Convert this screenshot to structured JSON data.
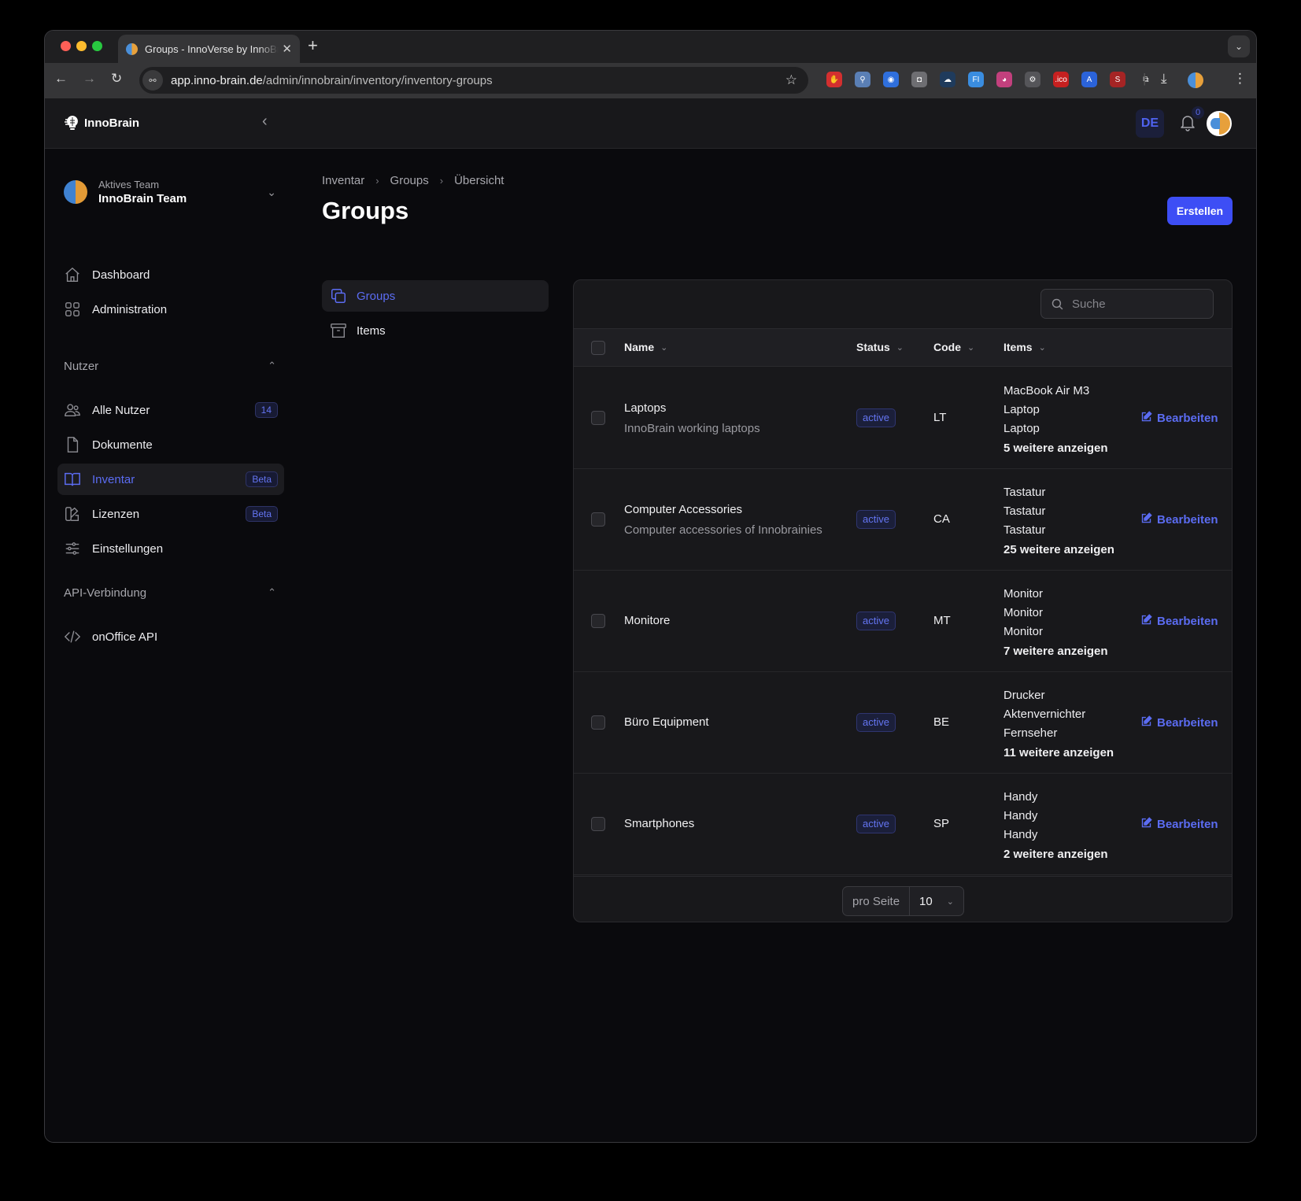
{
  "browser": {
    "tab_title": "Groups - InnoVerse by InnoBrain",
    "url_host": "app.inno-brain.de",
    "url_path": "/admin/innobrain/inventory/inventory-groups",
    "extensions": [
      {
        "name": "adblock-icon",
        "color": "#d32f2f",
        "glyph": "✋"
      },
      {
        "name": "magnifier-extension-icon",
        "color": "#5a7fb5",
        "glyph": "⚲"
      },
      {
        "name": "onepassword-icon",
        "color": "#2f6fdc",
        "glyph": "◉"
      },
      {
        "name": "camera-icon",
        "color": "#6e6e72",
        "glyph": "◘"
      },
      {
        "name": "cloud-extension-icon",
        "color": "#1f3b5c",
        "glyph": "☁"
      },
      {
        "name": "fi-extension-icon",
        "color": "#3a8de0",
        "glyph": "FI"
      },
      {
        "name": "octopus-extension-icon",
        "color": "#c2407d",
        "glyph": "◕"
      },
      {
        "name": "gear-extension-icon",
        "color": "#555559",
        "glyph": "⚙"
      },
      {
        "name": "ico-extension-icon",
        "color": "#c62020",
        "glyph": ".ico"
      },
      {
        "name": "translate-icon",
        "color": "#2b63d9",
        "glyph": "A"
      },
      {
        "name": "seo-extension-icon",
        "color": "#a52424",
        "glyph": "S"
      },
      {
        "name": "puzzle-icon",
        "color": "transparent",
        "glyph": "⧉"
      }
    ]
  },
  "app": {
    "brand": "InnoBrain",
    "lang": "DE",
    "notifications": "0"
  },
  "sidebar": {
    "team_label": "Aktives Team",
    "team_name": "InnoBrain Team",
    "items": [
      {
        "label": "Dashboard"
      },
      {
        "label": "Administration"
      }
    ],
    "section_users": "Nutzer",
    "users_items": [
      {
        "label": "Alle Nutzer",
        "badge": "14"
      },
      {
        "label": "Dokumente"
      },
      {
        "label": "Inventar",
        "badge": "Beta",
        "active": true
      },
      {
        "label": "Lizenzen",
        "badge": "Beta"
      },
      {
        "label": "Einstellungen"
      }
    ],
    "section_api": "API-Verbindung",
    "api_items": [
      {
        "label": "onOffice API"
      }
    ]
  },
  "main": {
    "breadcrumb": [
      "Inventar",
      "Groups",
      "Übersicht"
    ],
    "title": "Groups",
    "create_label": "Erstellen",
    "subnav": [
      {
        "label": "Groups",
        "active": true
      },
      {
        "label": "Items"
      }
    ],
    "search_placeholder": "Suche",
    "columns": [
      "Name",
      "Status",
      "Code",
      "Items"
    ],
    "edit_label": "Bearbeiten",
    "rows": [
      {
        "name": "Laptops",
        "description": "InnoBrain working laptops",
        "status": "active",
        "code": "LT",
        "items": [
          "MacBook Air M3",
          "Laptop",
          "Laptop"
        ],
        "more": "5 weitere anzeigen"
      },
      {
        "name": "Computer Accessories",
        "description": "Computer accessories of Innobrainies",
        "status": "active",
        "code": "CA",
        "items": [
          "Tastatur",
          "Tastatur",
          "Tastatur"
        ],
        "more": "25 weitere anzeigen"
      },
      {
        "name": "Monitore",
        "description": "",
        "status": "active",
        "code": "MT",
        "items": [
          "Monitor",
          "Monitor",
          "Monitor"
        ],
        "more": "7 weitere anzeigen"
      },
      {
        "name": "Büro Equipment",
        "description": "",
        "status": "active",
        "code": "BE",
        "items": [
          "Drucker",
          "Aktenvernichter",
          "Fernseher"
        ],
        "more": "11 weitere anzeigen"
      },
      {
        "name": "Smartphones",
        "description": "",
        "status": "active",
        "code": "SP",
        "items": [
          "Handy",
          "Handy",
          "Handy"
        ],
        "more": "2 weitere anzeigen"
      }
    ],
    "per_page_label": "pro Seite",
    "per_page_value": "10"
  },
  "colors": {
    "accent": "#3d4ef5",
    "accent_text": "#5b6cf2",
    "background": "#0a0a0d",
    "surface": "#18181b"
  }
}
